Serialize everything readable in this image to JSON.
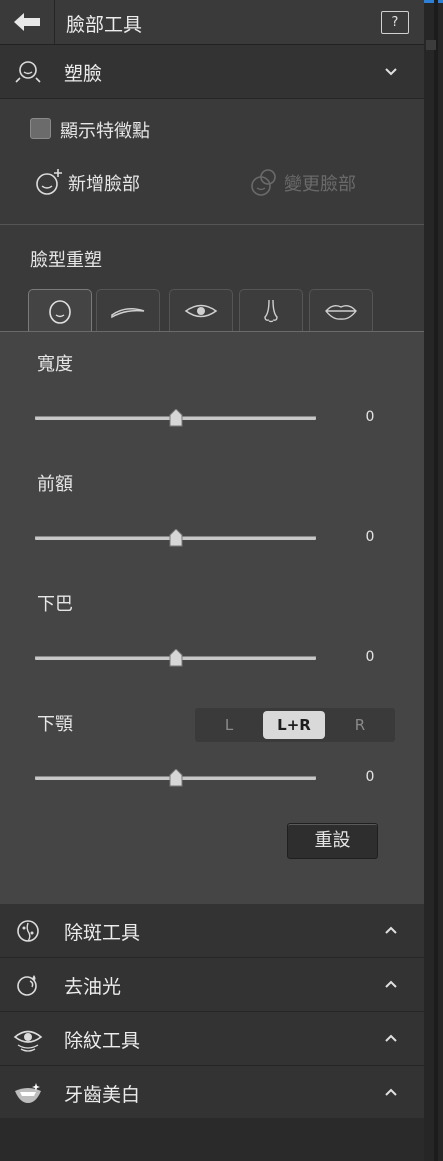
{
  "header": {
    "title": "臉部工具",
    "help_label": "?"
  },
  "sections": {
    "shape_face": {
      "label": "塑臉"
    },
    "spot_removal": {
      "label": "除斑工具"
    },
    "oil_removal": {
      "label": "去油光"
    },
    "wrinkle_removal": {
      "label": "除紋工具"
    },
    "teeth_whitening": {
      "label": "牙齒美白"
    }
  },
  "shape_face": {
    "show_features_label": "顯示特徵點",
    "show_features_checked": false,
    "add_face_label": "新增臉部",
    "change_face_label": "變更臉部",
    "reshape_title": "臉型重塑",
    "tabs": [
      {
        "icon": "face-contour-icon",
        "active": true
      },
      {
        "icon": "eyebrow-icon",
        "active": false
      },
      {
        "icon": "eye-icon",
        "active": false
      },
      {
        "icon": "nose-icon",
        "active": false
      },
      {
        "icon": "lips-icon",
        "active": false
      }
    ],
    "sliders": [
      {
        "label": "寬度",
        "value": "0",
        "level": 0.5
      },
      {
        "label": "前額",
        "value": "0",
        "level": 0.5
      },
      {
        "label": "下巴",
        "value": "0",
        "level": 0.5
      },
      {
        "label": "下顎",
        "value": "0",
        "level": 0.5
      }
    ],
    "jaw_side": {
      "options": [
        "L",
        "L+R",
        "R"
      ],
      "selected": "L+R"
    },
    "reset_label": "重設"
  },
  "colors": {
    "accent": "#2e7fd6",
    "panel_bg": "#454545",
    "header_bg": "#333333"
  }
}
